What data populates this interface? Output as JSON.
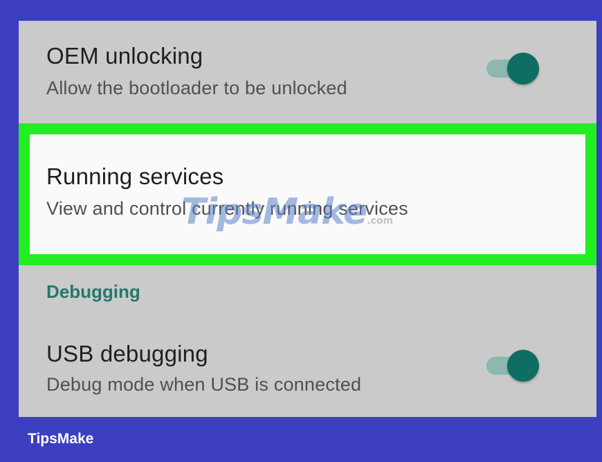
{
  "settings": {
    "oem_unlocking": {
      "title": "OEM unlocking",
      "summary": "Allow the bootloader to be unlocked",
      "toggle_state": "on"
    },
    "running_services": {
      "title": "Running services",
      "summary": "View and control currently running services",
      "highlighted": true
    },
    "debugging_header": "Debugging",
    "usb_debugging": {
      "title": "USB debugging",
      "summary": "Debug mode when USB is connected",
      "toggle_state": "on"
    }
  },
  "watermark": {
    "text": "TipsMake",
    "suffix": ".com"
  },
  "brand": "TipsMake",
  "colors": {
    "frame": "#3b3fbf",
    "screen_bg": "#cacaca",
    "highlight_border": "#22ee22",
    "accent_teal": "#0e6e63",
    "section_header": "#24786c"
  }
}
